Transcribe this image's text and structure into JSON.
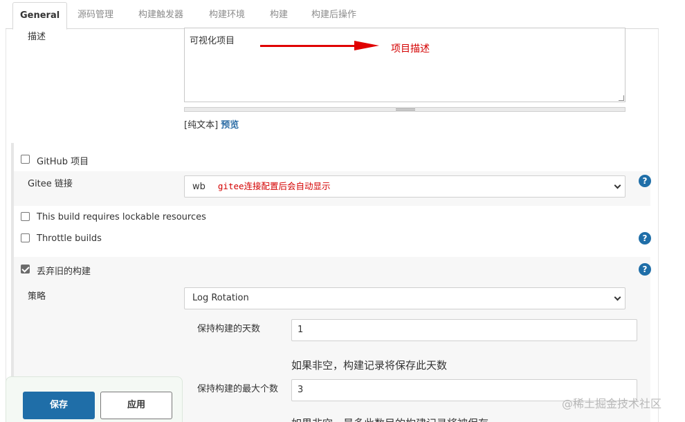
{
  "tabs": [
    {
      "label": "General"
    },
    {
      "label": "源码管理"
    },
    {
      "label": "构建触发器"
    },
    {
      "label": "构建环境"
    },
    {
      "label": "构建"
    },
    {
      "label": "构建后操作"
    }
  ],
  "description": {
    "label": "描述",
    "value": "可视化项目",
    "annotation": "项目描述",
    "plain_text": "[纯文本]",
    "preview": "预览"
  },
  "github_project": {
    "label": "GitHub 项目",
    "checked": false
  },
  "gitee": {
    "label": "Gitee 链接",
    "selected": "wb",
    "note": "gitee连接配置后会自动显示"
  },
  "lockable": {
    "label": "This build requires lockable resources",
    "checked": false
  },
  "throttle": {
    "label": "Throttle builds",
    "checked": false
  },
  "discard": {
    "label": "丢弃旧的构建",
    "checked": true
  },
  "strategy": {
    "label": "策略",
    "selected": "Log Rotation",
    "days_label": "保持构建的天数",
    "days_value": "1",
    "days_hint": "如果非空，构建记录将保存此天数",
    "max_label": "保持构建的最大个数",
    "max_value": "3",
    "max_hint": "如果非空，最多此数目的构建记录将被保存"
  },
  "buttons": {
    "save": "保存",
    "apply": "应用"
  },
  "watermark": "@稀土掘金技术社区",
  "icons": {
    "help": "?"
  },
  "colors": {
    "accent": "#1f6ea8",
    "annotation": "#d40000"
  }
}
